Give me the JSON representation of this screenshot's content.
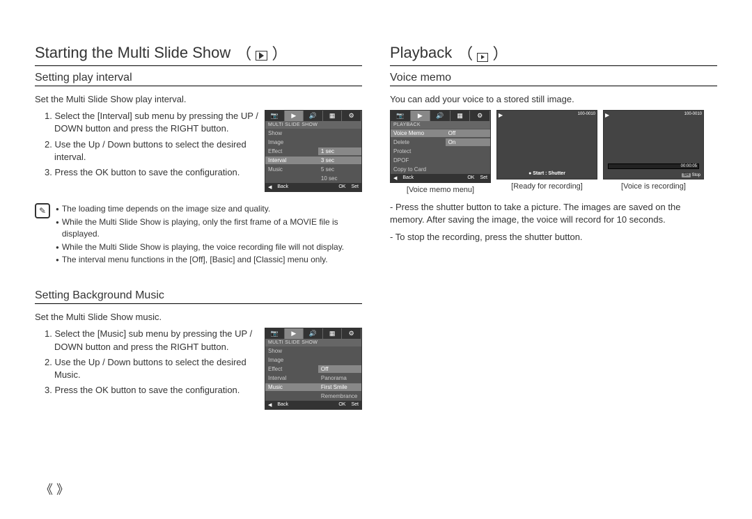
{
  "left": {
    "title": "Starting the Multi Slide Show",
    "icon_label": "slideshow-icon",
    "sec1": {
      "title": "Setting play interval",
      "intro": "Set the Multi Slide Show play interval.",
      "steps": [
        "1. Select the [Interval] sub menu by pressing the UP / DOWN button and press the RIGHT button.",
        "2. Use the Up / Down buttons to select the desired interval.",
        "3. Press the OK button to save the configuration."
      ],
      "cam": {
        "header": "MULTI SLIDE SHOW",
        "rows": [
          {
            "l": "Show",
            "r": ""
          },
          {
            "l": "Image",
            "r": ""
          },
          {
            "l": "Effect",
            "r": "1 sec"
          },
          {
            "l": "Interval",
            "r": "3 sec"
          },
          {
            "l": "Music",
            "r": "5 sec"
          },
          {
            "l": "",
            "r": "10 sec"
          }
        ],
        "footer_l1": "◀",
        "footer_l2": "Back",
        "footer_r1": "OK",
        "footer_r2": "Set"
      },
      "notes": [
        "The loading time depends on the image size and quality.",
        "While the Multi Slide Show is playing, only the first frame of a MOVIE file is displayed.",
        "While the Multi Slide Show is playing, the voice recording file will not display.",
        "The interval menu functions in the [Off], [Basic] and [Classic] menu only."
      ]
    },
    "sec2": {
      "title": "Setting Background Music",
      "intro": "Set the Multi Slide Show music.",
      "steps": [
        "1. Select the [Music] sub menu by pressing the UP / DOWN button and press the RIGHT button.",
        "2. Use the Up / Down buttons to select the desired Music.",
        "3. Press the OK button to save the configuration."
      ],
      "cam": {
        "header": "MULTI SLIDE SHOW",
        "rows": [
          {
            "l": "Show",
            "r": ""
          },
          {
            "l": "Image",
            "r": ""
          },
          {
            "l": "Effect",
            "r": "Off"
          },
          {
            "l": "Interval",
            "r": "Panorama"
          },
          {
            "l": "Music",
            "r": "First Smile"
          },
          {
            "l": "",
            "r": "Remembrance"
          }
        ],
        "footer_l1": "◀",
        "footer_l2": "Back",
        "footer_r1": "OK",
        "footer_r2": "Set"
      }
    }
  },
  "right": {
    "title": "Playback",
    "icon_label": "playback-icon",
    "sec1": {
      "title": "Voice memo",
      "intro": "You can add your voice to a stored still image.",
      "cam": {
        "header": "PLAYBACK",
        "rows": [
          {
            "l": "Voice Memo",
            "r": "Off"
          },
          {
            "l": "Delete",
            "r": "On"
          },
          {
            "l": "Protect",
            "r": ""
          },
          {
            "l": "DPOF",
            "r": ""
          },
          {
            "l": "Copy to Card",
            "r": ""
          }
        ],
        "footer_l1": "◀",
        "footer_l2": "Back",
        "footer_r1": "OK",
        "footer_r2": "Set"
      },
      "preview1": {
        "topinfo": "100-0010",
        "bottom": "● Start : Shutter",
        "label": "[Ready for recording]"
      },
      "preview2": {
        "topinfo": "100-0010",
        "time": "00:00:05",
        "sh": "SH",
        "stop": "Stop",
        "label": "[Voice is recording]"
      },
      "menu_label": "[Voice memo menu]",
      "after": [
        "- Press the shutter button to take a picture. The images are saved on the memory. After saving the image, the voice will record for 10 seconds.",
        "- To stop the recording, press the shutter button."
      ]
    }
  },
  "footer_marks": "《  》"
}
